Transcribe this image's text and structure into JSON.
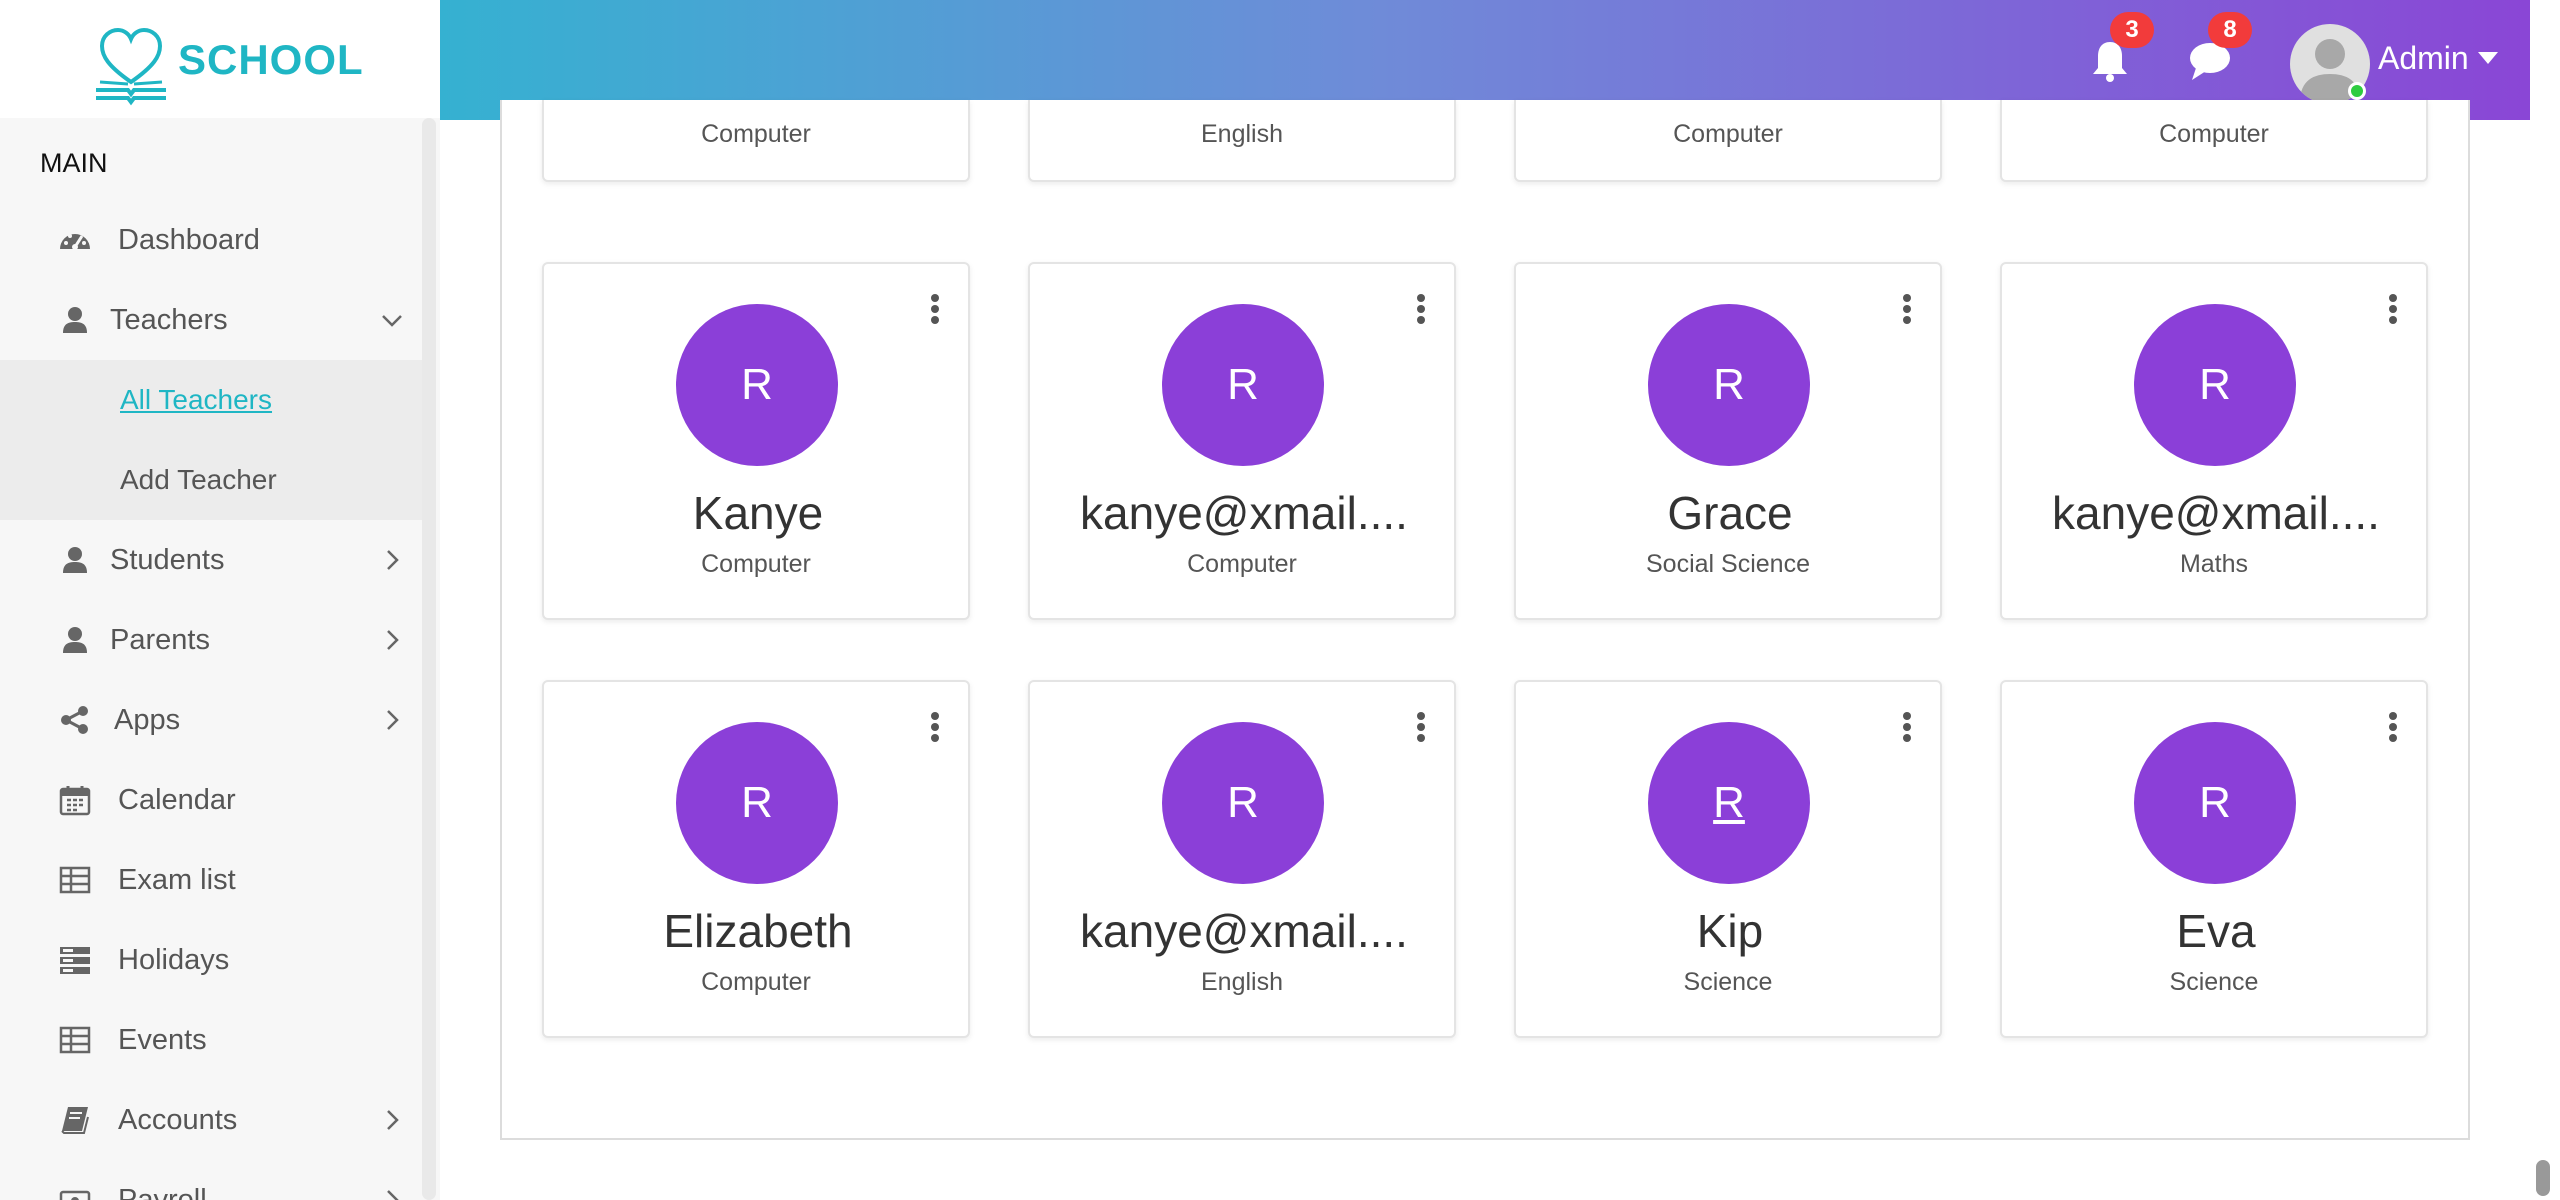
{
  "brand": {
    "name": "SCHOOL",
    "logo_icon": "heart-book-icon",
    "color": "#1fb6c4"
  },
  "sidebar": {
    "section_label": "MAIN",
    "items": [
      {
        "label": "Dashboard",
        "icon": "dashboard-icon",
        "chevron": "none"
      },
      {
        "label": "Teachers",
        "icon": "user-icon",
        "chevron": "down"
      },
      {
        "label": "Students",
        "icon": "user-icon",
        "chevron": "right"
      },
      {
        "label": "Parents",
        "icon": "user-icon",
        "chevron": "right"
      },
      {
        "label": "Apps",
        "icon": "share-icon",
        "chevron": "right"
      },
      {
        "label": "Calendar",
        "icon": "calendar-icon",
        "chevron": "none"
      },
      {
        "label": "Exam list",
        "icon": "table-icon",
        "chevron": "none"
      },
      {
        "label": "Holidays",
        "icon": "server-icon",
        "chevron": "none"
      },
      {
        "label": "Events",
        "icon": "table-icon",
        "chevron": "none"
      },
      {
        "label": "Accounts",
        "icon": "book-icon",
        "chevron": "right"
      },
      {
        "label": "Payroll",
        "icon": "money-icon",
        "chevron": "right"
      }
    ],
    "sub_items": [
      {
        "label": "All Teachers",
        "active": true
      },
      {
        "label": "Add Teacher",
        "active": false
      }
    ]
  },
  "header": {
    "notifications": {
      "icon": "bell-icon",
      "count": "3"
    },
    "messages": {
      "icon": "chat-icon",
      "count": "8"
    },
    "user": {
      "name": "Admin",
      "status": "online"
    },
    "gradient": [
      "#35b1d1",
      "#8a46d6"
    ]
  },
  "teachers_top_row": [
    "Computer",
    "English",
    "Computer",
    "Computer"
  ],
  "teachers": [
    {
      "initial": "R",
      "name": "Kanye",
      "subject": "Computer"
    },
    {
      "initial": "R",
      "name": "kanye@xmail....",
      "subject": "Computer"
    },
    {
      "initial": "R",
      "name": "Grace",
      "subject": "Social Science"
    },
    {
      "initial": "R",
      "name": "kanye@xmail....",
      "subject": "Maths"
    },
    {
      "initial": "R",
      "name": "Elizabeth",
      "subject": "Computer"
    },
    {
      "initial": "R",
      "name": "kanye@xmail....",
      "subject": "English"
    },
    {
      "initial": "R",
      "name": "Kip",
      "subject": "Science"
    },
    {
      "initial": "R",
      "name": "Eva",
      "subject": "Science"
    }
  ],
  "colors": {
    "avatar_bg": "#8b3fd8",
    "badge": "#f23b3b",
    "accent": "#1fb6c4"
  }
}
